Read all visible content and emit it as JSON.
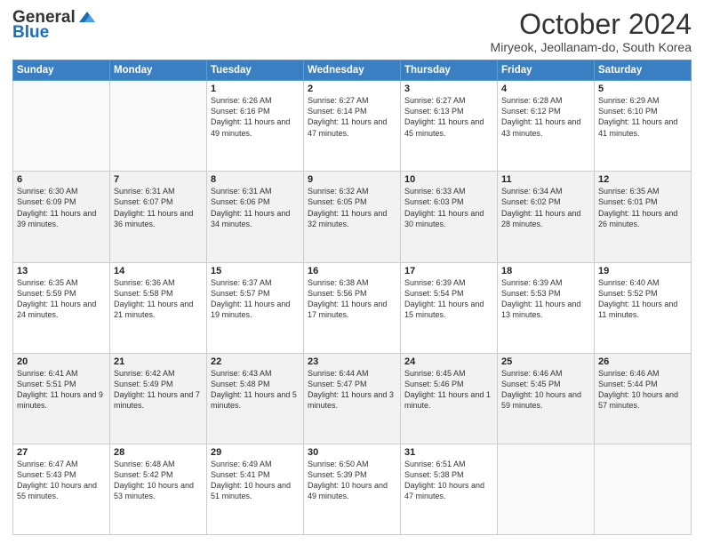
{
  "header": {
    "logo_general": "General",
    "logo_blue": "Blue",
    "month_title": "October 2024",
    "location": "Miryeok, Jeollanam-do, South Korea"
  },
  "days_of_week": [
    "Sunday",
    "Monday",
    "Tuesday",
    "Wednesday",
    "Thursday",
    "Friday",
    "Saturday"
  ],
  "weeks": [
    [
      {
        "day": "",
        "info": ""
      },
      {
        "day": "",
        "info": ""
      },
      {
        "day": "1",
        "info": "Sunrise: 6:26 AM\nSunset: 6:16 PM\nDaylight: 11 hours and 49 minutes."
      },
      {
        "day": "2",
        "info": "Sunrise: 6:27 AM\nSunset: 6:14 PM\nDaylight: 11 hours and 47 minutes."
      },
      {
        "day": "3",
        "info": "Sunrise: 6:27 AM\nSunset: 6:13 PM\nDaylight: 11 hours and 45 minutes."
      },
      {
        "day": "4",
        "info": "Sunrise: 6:28 AM\nSunset: 6:12 PM\nDaylight: 11 hours and 43 minutes."
      },
      {
        "day": "5",
        "info": "Sunrise: 6:29 AM\nSunset: 6:10 PM\nDaylight: 11 hours and 41 minutes."
      }
    ],
    [
      {
        "day": "6",
        "info": "Sunrise: 6:30 AM\nSunset: 6:09 PM\nDaylight: 11 hours and 39 minutes."
      },
      {
        "day": "7",
        "info": "Sunrise: 6:31 AM\nSunset: 6:07 PM\nDaylight: 11 hours and 36 minutes."
      },
      {
        "day": "8",
        "info": "Sunrise: 6:31 AM\nSunset: 6:06 PM\nDaylight: 11 hours and 34 minutes."
      },
      {
        "day": "9",
        "info": "Sunrise: 6:32 AM\nSunset: 6:05 PM\nDaylight: 11 hours and 32 minutes."
      },
      {
        "day": "10",
        "info": "Sunrise: 6:33 AM\nSunset: 6:03 PM\nDaylight: 11 hours and 30 minutes."
      },
      {
        "day": "11",
        "info": "Sunrise: 6:34 AM\nSunset: 6:02 PM\nDaylight: 11 hours and 28 minutes."
      },
      {
        "day": "12",
        "info": "Sunrise: 6:35 AM\nSunset: 6:01 PM\nDaylight: 11 hours and 26 minutes."
      }
    ],
    [
      {
        "day": "13",
        "info": "Sunrise: 6:35 AM\nSunset: 5:59 PM\nDaylight: 11 hours and 24 minutes."
      },
      {
        "day": "14",
        "info": "Sunrise: 6:36 AM\nSunset: 5:58 PM\nDaylight: 11 hours and 21 minutes."
      },
      {
        "day": "15",
        "info": "Sunrise: 6:37 AM\nSunset: 5:57 PM\nDaylight: 11 hours and 19 minutes."
      },
      {
        "day": "16",
        "info": "Sunrise: 6:38 AM\nSunset: 5:56 PM\nDaylight: 11 hours and 17 minutes."
      },
      {
        "day": "17",
        "info": "Sunrise: 6:39 AM\nSunset: 5:54 PM\nDaylight: 11 hours and 15 minutes."
      },
      {
        "day": "18",
        "info": "Sunrise: 6:39 AM\nSunset: 5:53 PM\nDaylight: 11 hours and 13 minutes."
      },
      {
        "day": "19",
        "info": "Sunrise: 6:40 AM\nSunset: 5:52 PM\nDaylight: 11 hours and 11 minutes."
      }
    ],
    [
      {
        "day": "20",
        "info": "Sunrise: 6:41 AM\nSunset: 5:51 PM\nDaylight: 11 hours and 9 minutes."
      },
      {
        "day": "21",
        "info": "Sunrise: 6:42 AM\nSunset: 5:49 PM\nDaylight: 11 hours and 7 minutes."
      },
      {
        "day": "22",
        "info": "Sunrise: 6:43 AM\nSunset: 5:48 PM\nDaylight: 11 hours and 5 minutes."
      },
      {
        "day": "23",
        "info": "Sunrise: 6:44 AM\nSunset: 5:47 PM\nDaylight: 11 hours and 3 minutes."
      },
      {
        "day": "24",
        "info": "Sunrise: 6:45 AM\nSunset: 5:46 PM\nDaylight: 11 hours and 1 minute."
      },
      {
        "day": "25",
        "info": "Sunrise: 6:46 AM\nSunset: 5:45 PM\nDaylight: 10 hours and 59 minutes."
      },
      {
        "day": "26",
        "info": "Sunrise: 6:46 AM\nSunset: 5:44 PM\nDaylight: 10 hours and 57 minutes."
      }
    ],
    [
      {
        "day": "27",
        "info": "Sunrise: 6:47 AM\nSunset: 5:43 PM\nDaylight: 10 hours and 55 minutes."
      },
      {
        "day": "28",
        "info": "Sunrise: 6:48 AM\nSunset: 5:42 PM\nDaylight: 10 hours and 53 minutes."
      },
      {
        "day": "29",
        "info": "Sunrise: 6:49 AM\nSunset: 5:41 PM\nDaylight: 10 hours and 51 minutes."
      },
      {
        "day": "30",
        "info": "Sunrise: 6:50 AM\nSunset: 5:39 PM\nDaylight: 10 hours and 49 minutes."
      },
      {
        "day": "31",
        "info": "Sunrise: 6:51 AM\nSunset: 5:38 PM\nDaylight: 10 hours and 47 minutes."
      },
      {
        "day": "",
        "info": ""
      },
      {
        "day": "",
        "info": ""
      }
    ]
  ]
}
